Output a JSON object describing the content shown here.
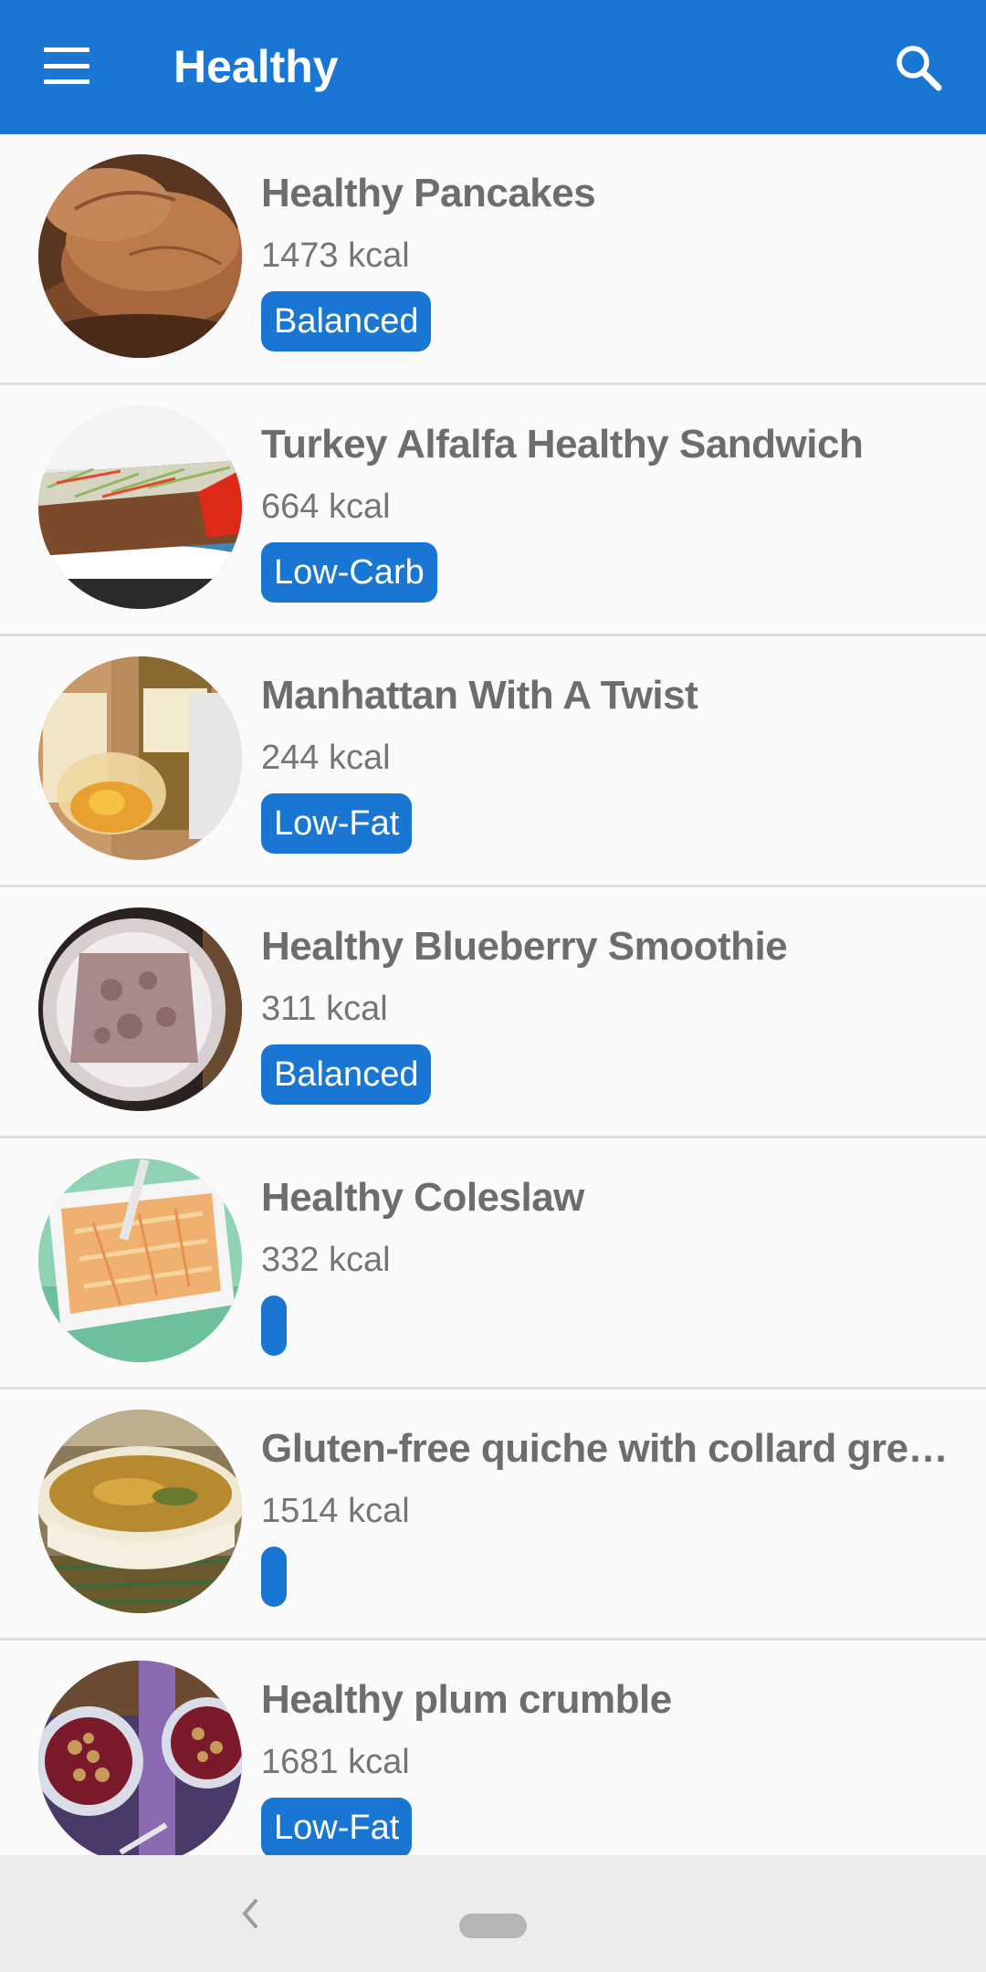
{
  "toolbar": {
    "title": "Healthy",
    "menu_icon": "hamburger-menu-icon",
    "search_icon": "search-icon",
    "color": "#1976d2"
  },
  "recipes": [
    {
      "title": "Healthy Pancakes",
      "kcal": "1473 kcal",
      "tag": "Balanced"
    },
    {
      "title": "Turkey Alfalfa Healthy Sandwich",
      "kcal": "664 kcal",
      "tag": "Low-Carb"
    },
    {
      "title": "Manhattan With A Twist",
      "kcal": "244 kcal",
      "tag": "Low-Fat"
    },
    {
      "title": "Healthy Blueberry Smoothie",
      "kcal": "311 kcal",
      "tag": "Balanced"
    },
    {
      "title": "Healthy Coleslaw",
      "kcal": "332 kcal",
      "tag": ""
    },
    {
      "title": "Gluten-free quiche with collard green…",
      "kcal": "1514 kcal",
      "tag": ""
    },
    {
      "title": "Healthy plum crumble",
      "kcal": "1681 kcal",
      "tag": "Low-Fat"
    }
  ],
  "navbar": {
    "back_icon": "back-chevron-icon",
    "home_icon": "home-pill-icon"
  }
}
